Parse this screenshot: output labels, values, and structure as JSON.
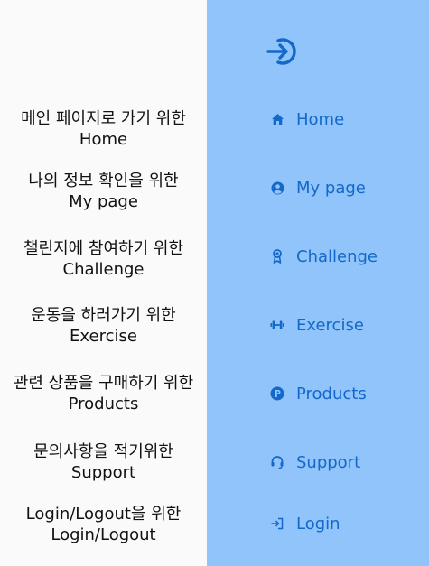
{
  "descriptions": [
    {
      "line1": "메인 페이지로 가기 위한",
      "line2": "Home"
    },
    {
      "line1": "나의 정보 확인을 위한",
      "line2": "My page"
    },
    {
      "line1": "챌린지에 참여하기 위한",
      "line2": "Challenge"
    },
    {
      "line1": "운동을 하러가기 위한",
      "line2": "Exercise"
    },
    {
      "line1": "관련 상품을 구매하기 위한",
      "line2": "Products"
    },
    {
      "line1": "문의사항을 적기위한",
      "line2": "Support"
    },
    {
      "line1": "Login/Logout을 위한",
      "line2": "Login/Logout"
    }
  ],
  "sidebar": {
    "toggle_icon": "login-arrow-icon",
    "items": [
      {
        "label": "Home",
        "icon": "home-icon"
      },
      {
        "label": "My page",
        "icon": "user-circle-icon"
      },
      {
        "label": "Challenge",
        "icon": "award-icon"
      },
      {
        "label": "Exercise",
        "icon": "dumbbell-icon"
      },
      {
        "label": "Products",
        "icon": "parking-p-icon"
      },
      {
        "label": "Support",
        "icon": "headset-icon"
      },
      {
        "label": "Login",
        "icon": "sign-in-icon"
      }
    ]
  },
  "colors": {
    "sidebar_bg": "#90c4fa",
    "accent": "#1368c9",
    "page_bg": "#fafafa"
  }
}
